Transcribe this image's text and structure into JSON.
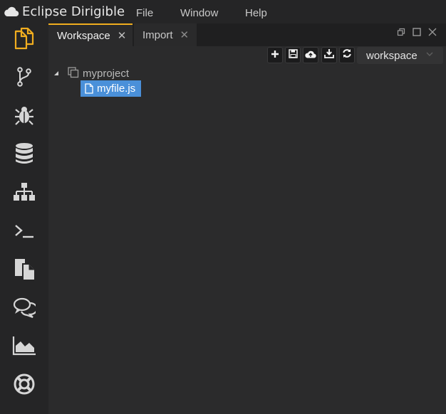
{
  "app": {
    "brand_name": "Eclipse Dirigible",
    "menu": [
      "File",
      "Window",
      "Help"
    ]
  },
  "activity_bar": {
    "icons": [
      "workspace-icon",
      "git-icon",
      "debug-icon",
      "database-icon",
      "hierarchy-icon",
      "terminal-icon",
      "copy-icon",
      "chat-icon",
      "chart-icon",
      "help-icon"
    ]
  },
  "tabs": [
    {
      "label": "Workspace",
      "close": "✕",
      "active": true
    },
    {
      "label": "Import",
      "close": "✕",
      "active": false
    }
  ],
  "toolbar": {
    "buttons": [
      "plus-icon",
      "save-icon",
      "upload-icon",
      "download-icon",
      "refresh-icon"
    ],
    "workspace_select": "workspace"
  },
  "tree": {
    "project": "myproject",
    "file": "myfile.js"
  },
  "colors": {
    "accent": "#f0ad1f",
    "selection": "#4a90d9",
    "background": "#2b2b2c",
    "sidebar": "#252526"
  }
}
